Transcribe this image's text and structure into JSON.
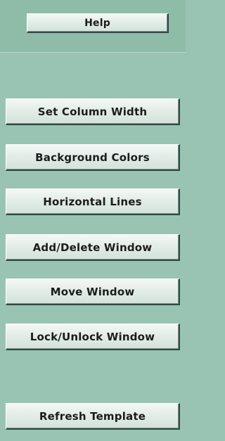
{
  "header": {
    "help_label": "Help"
  },
  "menu": {
    "set_column_width_label": "Set Column Width",
    "background_colors_label": "Background Colors",
    "horizontal_lines_label": "Horizontal Lines",
    "add_delete_window_label": "Add/Delete Window",
    "move_window_label": "Move Window",
    "lock_unlock_window_label": "Lock/Unlock Window"
  },
  "footer": {
    "refresh_template_label": "Refresh Template"
  },
  "colors": {
    "panel_background": "#99c4b3",
    "button_face": "#e3ede8",
    "button_border": "#2f4a44"
  }
}
